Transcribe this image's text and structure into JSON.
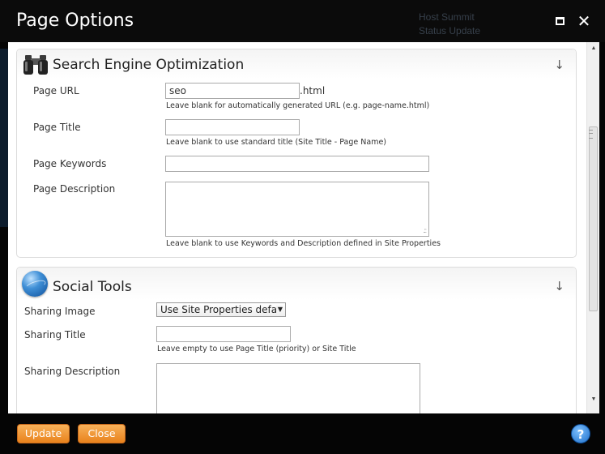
{
  "dialog": {
    "title": "Page Options"
  },
  "background": {
    "text1": "Host Summit",
    "text2": "Status Update"
  },
  "seo": {
    "title": "Search Engine Optimization",
    "page_url_label": "Page URL",
    "page_url_value": "seo",
    "page_url_suffix": ".html",
    "page_url_hint": "Leave blank for automatically generated URL (e.g. page-name.html)",
    "page_title_label": "Page Title",
    "page_title_value": "",
    "page_title_hint": "Leave blank to use standard title (Site Title - Page Name)",
    "page_keywords_label": "Page Keywords",
    "page_keywords_value": "",
    "page_description_label": "Page Description",
    "page_description_value": "",
    "page_description_hint": "Leave blank to use Keywords and Description defined in Site Properties"
  },
  "social": {
    "title": "Social Tools",
    "sharing_image_label": "Sharing Image",
    "sharing_image_value": "Use Site Properties defau",
    "sharing_title_label": "Sharing Title",
    "sharing_title_value": "",
    "sharing_title_hint": "Leave empty to use Page Title (priority) or Site Title",
    "sharing_description_label": "Sharing Description",
    "sharing_description_value": ""
  },
  "footer": {
    "update_label": "Update",
    "close_label": "Close",
    "help_label": "?"
  },
  "colors": {
    "button_orange": "#ec8a26",
    "dialog_bg": "#050505",
    "help_blue": "#1f6fc9"
  }
}
